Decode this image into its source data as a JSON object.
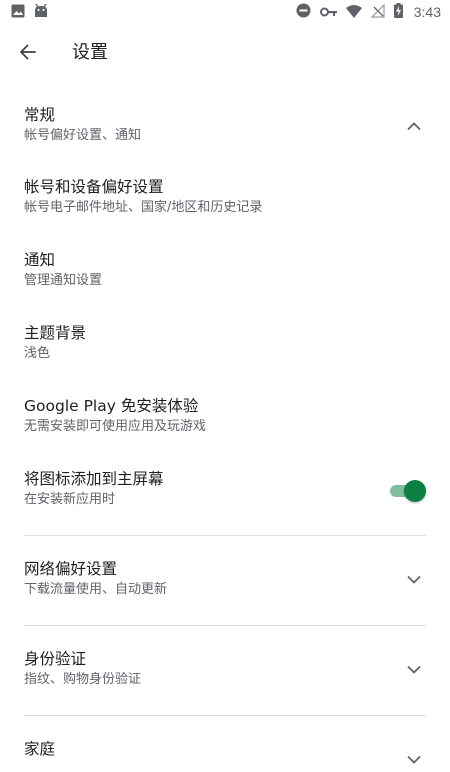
{
  "status_bar": {
    "time": "3:43",
    "left_icons": [
      "image-icon",
      "android-icon"
    ],
    "right_icons": [
      "do-not-disturb-icon",
      "vpn-key-icon",
      "wifi-icon",
      "no-signal-icon",
      "battery-charging-icon"
    ]
  },
  "app_bar": {
    "back_icon": "arrow-back-icon",
    "title": "设置"
  },
  "settings": {
    "general": {
      "title": "常规",
      "subtitle": "帐号偏好设置、通知",
      "expanded": true
    },
    "account": {
      "title": "帐号和设备偏好设置",
      "subtitle": "帐号电子邮件地址、国家/地区和历史记录"
    },
    "notifications": {
      "title": "通知",
      "subtitle": "管理通知设置"
    },
    "theme": {
      "title": "主题背景",
      "subtitle": "浅色"
    },
    "instant": {
      "title": "Google Play 免安装体验",
      "subtitle": "无需安装即可使用应用及玩游戏"
    },
    "add_icon": {
      "title": "将图标添加到主屏幕",
      "subtitle": "在安装新应用时",
      "enabled": true
    },
    "network": {
      "title": "网络偏好设置",
      "subtitle": "下载流量使用、自动更新",
      "expanded": false
    },
    "auth": {
      "title": "身份验证",
      "subtitle": "指纹、购物身份验证",
      "expanded": false
    },
    "family": {
      "title": "家庭",
      "expanded": false
    }
  },
  "colors": {
    "accent": "#0b8043",
    "track": "#7fbf9e",
    "divider": "#dadce0"
  }
}
